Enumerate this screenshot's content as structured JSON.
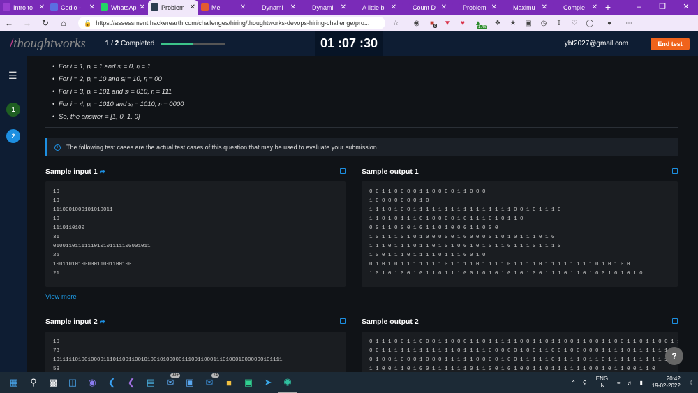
{
  "browser": {
    "tabs": [
      {
        "title": "Intro to",
        "color": "#9a3fd0"
      },
      {
        "title": "Codio -",
        "color": "#5b6ee1"
      },
      {
        "title": "WhatsAp",
        "color": "#25d366"
      },
      {
        "title": "Problem",
        "color": "#2c3e50",
        "active": true
      },
      {
        "title": "Me",
        "color": "#e35b2f"
      },
      {
        "title": "Dynami",
        "color": "#7a2bb8"
      },
      {
        "title": "Dynami",
        "color": "#7a2bb8"
      },
      {
        "title": "A little b",
        "color": "#7a2bb8"
      },
      {
        "title": "Count D",
        "color": "#7a2bb8"
      },
      {
        "title": "Problem",
        "color": "#7a2bb8"
      },
      {
        "title": "Maximu",
        "color": "#7a2bb8"
      },
      {
        "title": "Comple",
        "color": "#7a2bb8"
      }
    ],
    "url": "https://assessment.hackerearth.com/challenges/hiring/thoughtworks-devops-hiring-challenge/pro...",
    "ext_badge_1": "8",
    "ext_badge_2": "1.4k"
  },
  "header": {
    "logo": "thoughtworks",
    "progress_label": "1 / 2",
    "progress_suffix": "Completed",
    "progress_fraction": 0.5,
    "timer": "01 :07 :30",
    "email": "ybt2027@gmail.com",
    "end_test": "End test"
  },
  "sidebar": {
    "questions": [
      {
        "num": "1",
        "color": "#1f5f22"
      },
      {
        "num": "2",
        "color": "#1d8fe1"
      }
    ]
  },
  "explanation": [
    "For i = 1, pᵢ = 1 and sᵢ = 0, rᵢ = 1",
    "For i = 2, pᵢ = 10 and sᵢ = 10, rᵢ = 00",
    "For i = 3, pᵢ = 101 and sᵢ = 010, rᵢ = 111",
    "For i = 4, pᵢ = 1010 and sᵢ = 1010, rᵢ = 0000",
    "So, the answer = [1, 0, 1, 0]"
  ],
  "info_text": "The following test cases are the actual test cases of this question that may be used to evaluate your submission.",
  "sample1": {
    "input_title": "Sample input 1",
    "output_title": "Sample output 1",
    "input_lines": [
      "10",
      "19",
      "1110001000101010011",
      "10",
      "1110110100",
      "31",
      "0100110111111010101111100001011",
      "25",
      "1001101010000011001100100",
      "21"
    ],
    "output_lines": [
      "0 0 1 1 0 0 0 0 1 1 0 0 0 0 1 1 0 0 0",
      "1 0 0 0 0 0 0 0 1 0",
      "1 1 1 0 1 0 0 1 1 1 1 1 1 1 1 1 1 1 1 1 1 1 1 0 0 1 0 1 1 1 0",
      "1 1 0 1 0 1 1 1 0 1 0 0 0 0 1 0 1 1 1 0 1 0 1 1 0",
      "0 0 1 1 0 0 0 1 0 1 1 0 1 0 0 0 1 1 0 0 0",
      "1 0 1 1 1 0 1 0 1 0 0 0 0 0 1 0 0 0 0 0 1 0 1 0 1 1 1 0 1 0",
      "1 1 1 0 1 1 1 0 1 1 0 1 0 1 0 0 1 0 1 0 1 1 0 1 1 1 0 1 1 1 0",
      "1 0 0 1 1 1 0 1 1 1 1 0 1 1 1 0 0 1 0",
      "0 1 0 1 0 1 1 1 1 1 1 1 0 1 1 1 1 0 1 1 1 1 0 1 1 1 1 0 1 1 1 1 1 1 1 1 0 1 0 1 0 0",
      "1 0 1 0 1 0 0 1 0 1 1 0 1 1 1 0 0 1 0 1 0 1 0 1 0 1 0 0 1 1 1 0 1 1 0 1 0 0 1 0 1 0 1 0"
    ]
  },
  "view_more": "View more",
  "sample2": {
    "input_title": "Sample input 2",
    "output_title": "Sample output 2",
    "input_lines": [
      "10",
      "73",
      "1011111010010000111011001100101001010000011100110001110100010000000101111",
      "59"
    ],
    "output_lines": [
      "0 1 1 1 0 0 1 1 0 0 0 1 1 0 0 0 1 1 0 1 1 1 1 1 0 0 1 1 0 1 1 0 0 1 1 0 0 1 1 0 0 1 1 0 1 1 0 0 1 1 1",
      "0 0 1 1 1 1 1 1 1 1 1 1 1 1 0 1 1 1 1 0 0 0 0 0 1 0 0 1 1 0 0 1 0 0 0 0 0 1 1 1 1 0 1 1 1 1 1 1",
      "0 1 0 0 1 0 0 0 1 0 0 0 1 1 1 1 1 0 0 0 0 1 0 0 1 1 1 1 1 0 1 1 1 1 0 1 1 0 1 1 1 1 1 1 1 1 1 1 1",
      "1 1 0 0 1 1 0 1 0 0 1 1 1 1 1 1 0 1 1 0 0 1 0 1 0 0 1 1 0 1 1 1 1 1 1 0 0 1 0 1 1 0 0 1 1 0"
    ]
  },
  "help": "?",
  "taskbar": {
    "badge_mail": "99+",
    "badge_other": "74",
    "lang_top": "ENG",
    "lang_bottom": "IN",
    "time": "20:42",
    "date": "19-02-2022"
  }
}
